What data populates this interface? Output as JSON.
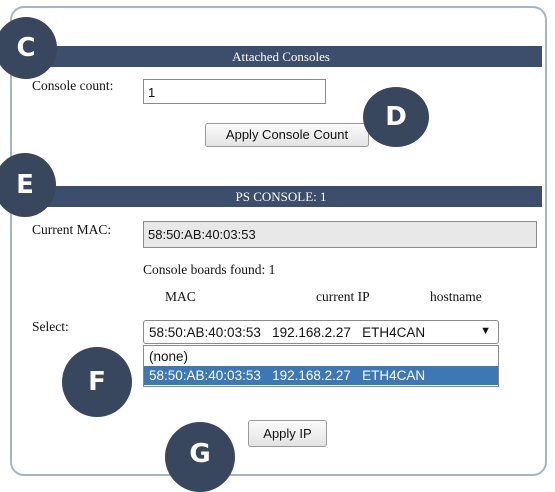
{
  "attached": {
    "title": "Attached Consoles",
    "count_label": "Console count:",
    "count_value": "1",
    "apply_label": "Apply Console Count"
  },
  "ps": {
    "title": "PS CONSOLE: 1",
    "mac_label": "Current MAC:",
    "mac_value": "58:50:AB:40:03:53",
    "found_text": "Console boards found: 1",
    "columns": {
      "mac": "MAC",
      "ip": "current IP",
      "hostname": "hostname"
    },
    "select_label": "Select:",
    "selected_value": "58:50:AB:40:03:53   192.168.2.27   ETH4CAN",
    "arrow": "▼",
    "options": [
      {
        "label": "(none)",
        "selected": false
      },
      {
        "label": "58:50:AB:40:03:53   192.168.2.27   ETH4CAN",
        "selected": true
      }
    ],
    "apply_ip_label": "Apply IP"
  },
  "callouts": {
    "c": "C",
    "d": "D",
    "e": "E",
    "f": "F",
    "g": "G"
  },
  "colors": {
    "bar": "#3c4e6b",
    "callout": "#38475d",
    "highlight": "#3d78b5"
  }
}
